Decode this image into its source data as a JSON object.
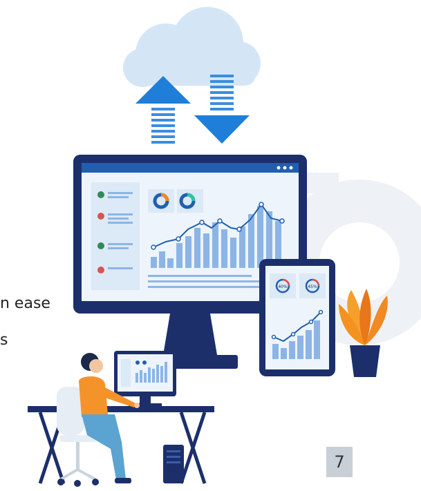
{
  "text_fragments": [
    "n ease",
    "s"
  ],
  "page_number": "7",
  "tablet_gauges": [
    "40%",
    "45%"
  ],
  "colors": {
    "primary_blue": "#1f5fb0",
    "dark_navy": "#1c2f6b",
    "cloud": "#d4e6f6",
    "bars": "#8cb5e6",
    "plant_orange": "#f08a24",
    "shirt_orange": "#f5932b",
    "pants_blue": "#5ba3d0",
    "page_box": "#c9cfd6"
  },
  "icons": [
    "cloud-icon",
    "upload-arrow-icon",
    "download-arrow-icon",
    "gear-icon",
    "plant-icon",
    "person-icon",
    "chair-icon"
  ]
}
